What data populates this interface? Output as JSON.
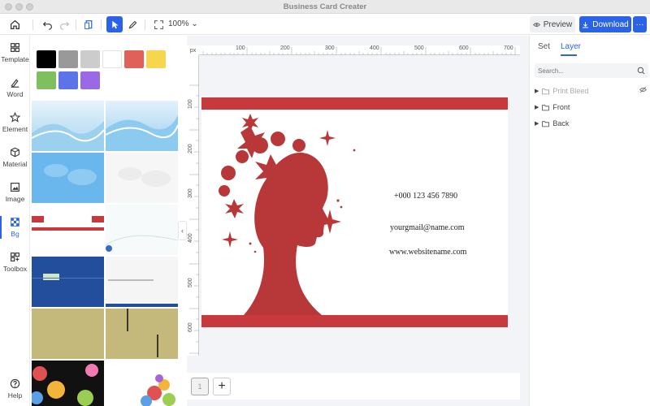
{
  "window": {
    "title": "Business Card Creater"
  },
  "toolbar": {
    "zoom": "100%",
    "preview_label": "Preview",
    "download_label": "Download",
    "more_label": "···"
  },
  "leftnav": {
    "items": [
      {
        "label": "Template",
        "icon": "template-icon"
      },
      {
        "label": "Word",
        "icon": "text-icon"
      },
      {
        "label": "Element",
        "icon": "star-icon"
      },
      {
        "label": "Material",
        "icon": "cube-icon"
      },
      {
        "label": "Image",
        "icon": "image-icon"
      },
      {
        "label": "Bg",
        "icon": "background-icon",
        "active": true
      },
      {
        "label": "Toolbox",
        "icon": "toolbox-icon"
      },
      {
        "label": "Help",
        "icon": "help-icon"
      }
    ]
  },
  "panel": {
    "swatches": [
      "#000000",
      "#999999",
      "#cccccc",
      "#ffffff",
      "#e0605a",
      "#f8d54f",
      "#7fbf5e",
      "#5b74e8",
      "#9a6ae6"
    ]
  },
  "ruler": {
    "unit": "px",
    "h_ticks": [
      "100",
      "200",
      "300",
      "400",
      "500",
      "600",
      "700"
    ],
    "v_ticks": [
      "100",
      "200",
      "300",
      "400",
      "500",
      "600"
    ]
  },
  "card": {
    "phone": "+000 123 456 7890",
    "email": "yourgmail@name.com",
    "website": "www.websitename.com",
    "accent": "#c6393c"
  },
  "pages": {
    "current": "1",
    "add_label": "+"
  },
  "rightpanel": {
    "tabs": [
      "Set",
      "Layer"
    ],
    "active_tab": "Layer",
    "search_placeholder": "Search...",
    "layers": [
      {
        "name": "Print Bleed",
        "hidden": true
      },
      {
        "name": "Front",
        "hidden": false
      },
      {
        "name": "Back",
        "hidden": false
      }
    ]
  }
}
